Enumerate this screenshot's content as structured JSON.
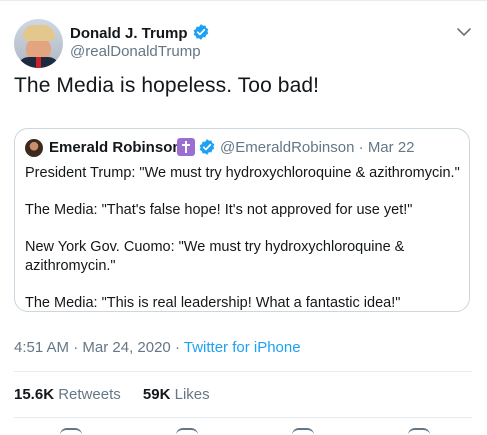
{
  "author": {
    "name": "Donald J. Trump",
    "handle": "@realDonaldTrump",
    "verified_icon": "verified-badge-icon"
  },
  "tweet": {
    "text": "The Media is hopeless. Too bad!"
  },
  "quoted_tweet": {
    "name": "Emerald Robinson",
    "emoji_icon": "latin-cross-icon",
    "handle": "@EmeraldRobinson",
    "separator": "·",
    "date": "Mar 22",
    "paragraphs": [
      "President Trump: \"We must try hydroxychloroquine & azithromycin.\"",
      "The Media: \"That's false hope! It's not approved for use yet!\"",
      "New York Gov. Cuomo: \"We must try hydroxychloroquine & azithromycin.\"",
      "The Media: \"This is real leadership! What a fantastic idea!\""
    ]
  },
  "meta": {
    "time": "4:51 AM",
    "separator1": "·",
    "date": "Mar 24, 2020",
    "separator2": "·",
    "source": "Twitter for iPhone"
  },
  "stats": {
    "retweets_count": "15.6K",
    "retweets_label": "Retweets",
    "likes_count": "59K",
    "likes_label": "Likes"
  },
  "colors": {
    "accent": "#1da1f2",
    "secondary_text": "#657786",
    "primary_text": "#14171a",
    "border": "#ccd6dd"
  }
}
